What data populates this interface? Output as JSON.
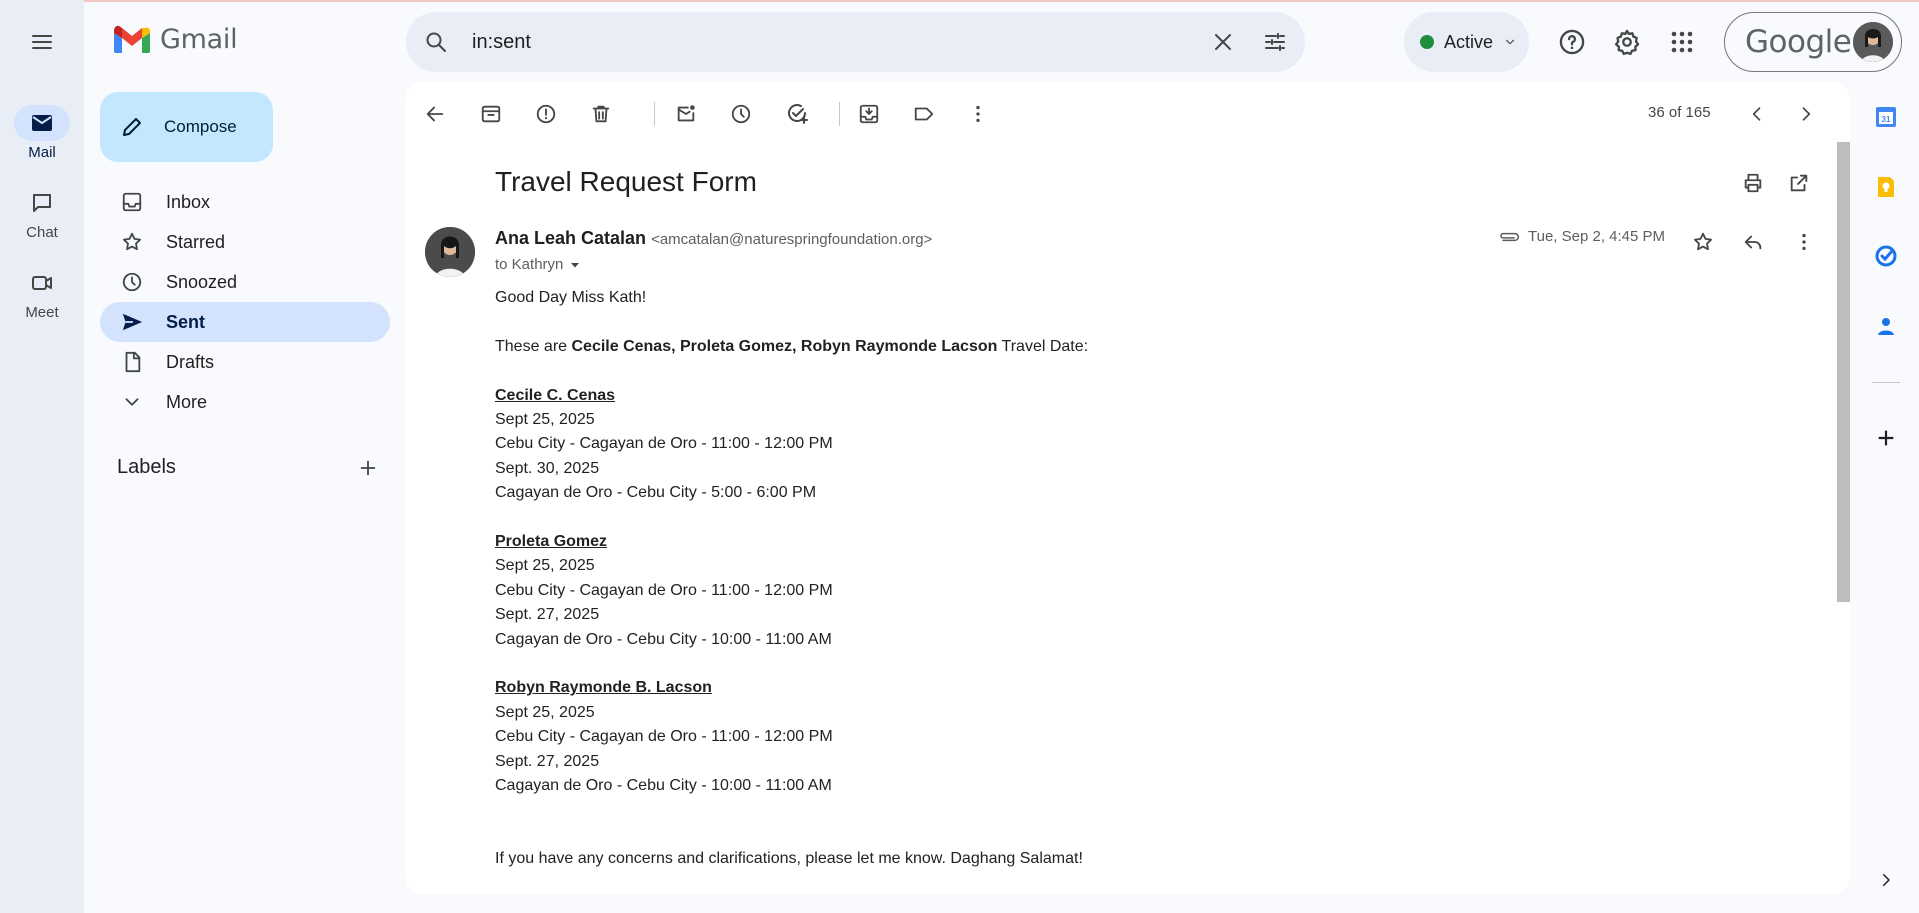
{
  "app": {
    "name": "Gmail"
  },
  "rail": {
    "items": [
      {
        "label": "Mail",
        "icon": "mail-icon",
        "active": true
      },
      {
        "label": "Chat",
        "icon": "chat-icon",
        "active": false
      },
      {
        "label": "Meet",
        "icon": "video-icon",
        "active": false
      }
    ]
  },
  "compose": {
    "label": "Compose"
  },
  "nav": {
    "items": [
      {
        "label": "Inbox",
        "icon": "inbox-icon"
      },
      {
        "label": "Starred",
        "icon": "star-icon"
      },
      {
        "label": "Snoozed",
        "icon": "clock-icon"
      },
      {
        "label": "Sent",
        "icon": "send-icon",
        "active": true
      },
      {
        "label": "Drafts",
        "icon": "draft-icon"
      },
      {
        "label": "More",
        "icon": "chevron-down-icon"
      }
    ]
  },
  "labels": {
    "title": "Labels"
  },
  "search": {
    "value": "in:sent"
  },
  "status": {
    "label": "Active",
    "color": "#1e8e3e"
  },
  "account": {
    "brand": "Google"
  },
  "toolbar": {
    "pager": "36 of 165"
  },
  "email": {
    "subject": "Travel Request Form",
    "sender_name": "Ana Leah Catalan",
    "sender_email": "<amcatalan@naturespringfoundation.org>",
    "to": "to Kathryn",
    "date": "Tue, Sep 2, 4:45 PM",
    "greeting": "Good Day Miss Kath!",
    "intro_before": "These are ",
    "intro_bold": "Cecile Cenas, Proleta Gomez, Robyn Raymonde Lacson",
    "intro_after": " Travel Date:",
    "people": [
      {
        "name": "Cecile C. Cenas",
        "lines": [
          "Sept 25, 2025",
          "Cebu City - Cagayan de Oro - 11:00 - 12:00 PM",
          "Sept. 30, 2025",
          "Cagayan de Oro -  Cebu City - 5:00 - 6:00 PM"
        ]
      },
      {
        "name": "Proleta Gomez",
        "lines": [
          "Sept 25, 2025",
          "Cebu City - Cagayan de Oro - 11:00 - 12:00 PM",
          "Sept. 27, 2025",
          "Cagayan de Oro -  Cebu City - 10:00 - 11:00 AM"
        ]
      },
      {
        "name": "Robyn Raymonde B. Lacson",
        "lines": [
          "Sept 25, 2025",
          "Cebu City - Cagayan de Oro - 11:00 - 12:00 PM",
          "Sept. 27, 2025",
          "Cagayan de Oro -  Cebu City - 10:00 - 11:00 AM"
        ]
      }
    ],
    "closing": "If you have any concerns and clarifications, please let me know. Daghang Salamat!"
  },
  "side_panel": {
    "calendar_day": "31"
  }
}
